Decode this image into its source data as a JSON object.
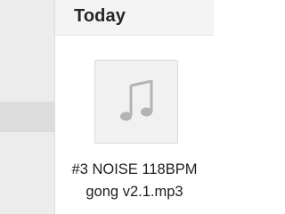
{
  "section": {
    "title": "Today"
  },
  "file": {
    "name_line1": "#3 NOISE 118BPM",
    "name_line2": "gong v2.1.mp3",
    "icon": "music-note-icon"
  }
}
